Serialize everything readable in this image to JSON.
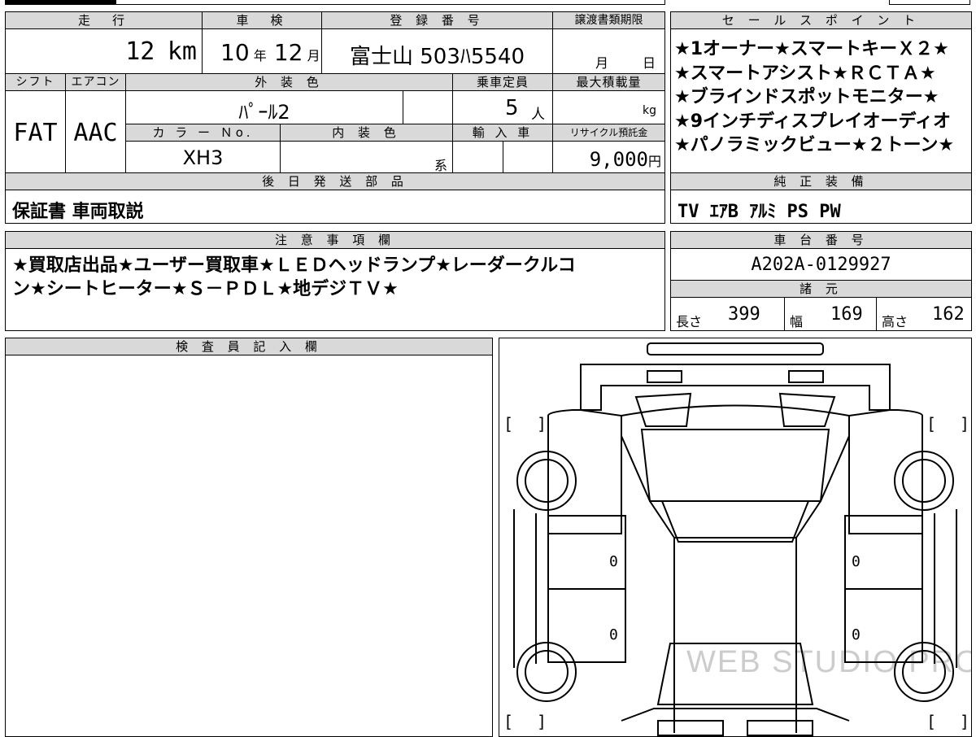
{
  "top_row": {
    "mileage_label": "走　行",
    "mileage_value": "12",
    "mileage_unit": "km",
    "inspection_label": "車　検",
    "inspection_year": "10",
    "inspection_year_unit": "年",
    "inspection_month": "12",
    "inspection_month_unit": "月",
    "registration_label": "登 録 番 号",
    "registration_value": "富士山 503ﾊ5540",
    "transfer_label": "譲渡書類期限",
    "transfer_month_unit": "月",
    "transfer_day_unit": "日"
  },
  "second_row": {
    "shift_label": "シフト",
    "shift_value": "FAT",
    "ac_label": "エアコン",
    "ac_value": "AAC",
    "exterior_label": "外 装 色",
    "exterior_value": "ﾊﾟｰﾙ2",
    "capacity_label": "乗車定員",
    "capacity_value": "5",
    "capacity_unit": "人",
    "load_label": "最大積載量",
    "load_unit": "kg",
    "color_no_label": "カ ラ ー Ｎo.",
    "color_no_value": "XH3",
    "interior_label": "内 装 色",
    "interior_unit": "系",
    "import_label": "輸 入 車",
    "recycle_label": "リサイクル預託金",
    "recycle_value": "9,000",
    "recycle_unit": "円"
  },
  "later_parts": {
    "label": "後 日 発 送 部 品",
    "value": "保証書 車両取説"
  },
  "sales_points": {
    "label": "セ ー ル ス ポ イ ン ト",
    "lines": [
      "★1オーナー★スマートキーＸ２★",
      "★スマートアシスト★ＲＣＴＡ★",
      "★ブラインドスポットモニター★",
      "★9インチディスプレイオーディオ",
      "★パノラミックビュー★２トーン★"
    ]
  },
  "genuine_equipment": {
    "label": "純 正 装 備",
    "value": "TV ｴｱB ｱﾙﾐ PS PW"
  },
  "notes": {
    "label": "注 意 事 項 欄",
    "value": "★買取店出品★ユーザー買取車★ＬＥＤヘッドランプ★レーダークルコン★シートヒーター★Ｓ－ＰＤＬ★地デジＴＶ★"
  },
  "chassis": {
    "label": "車 台 番 号",
    "value": "A202A-0129927"
  },
  "specs": {
    "label": "諸 元",
    "length_label": "長さ",
    "length_value": "399",
    "width_label": "幅",
    "width_value": "169",
    "height_label": "高さ",
    "height_value": "162"
  },
  "inspector": {
    "label": "検 査 員 記 入 欄"
  },
  "diagram": {
    "bracket_left": "[",
    "bracket_right": "]",
    "door_marks": [
      "0",
      "0",
      "0",
      "0"
    ],
    "watermark": "WEB STUDIO PRO"
  }
}
